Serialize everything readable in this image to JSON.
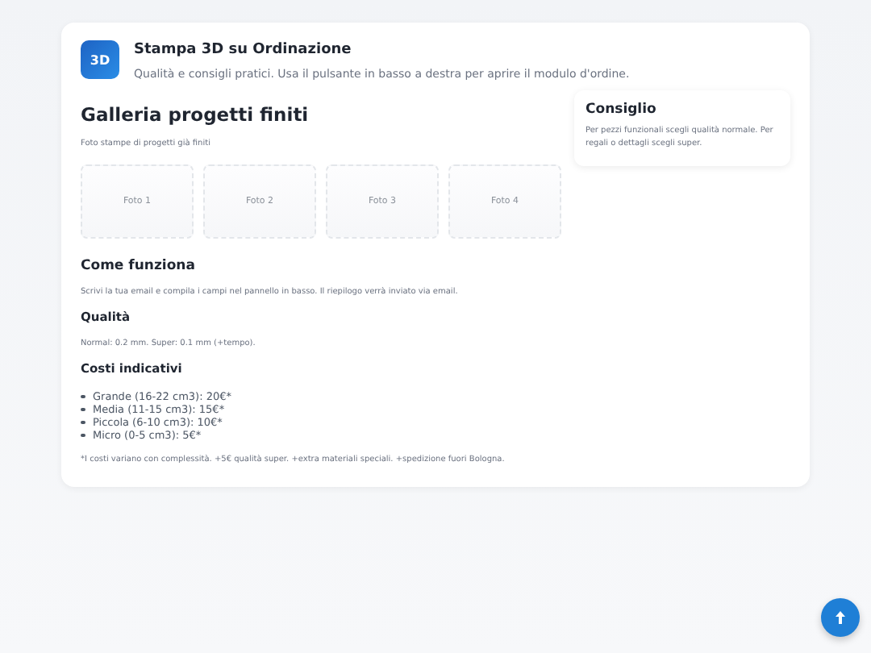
{
  "header": {
    "logo": "3D",
    "title": "Stampa 3D su Ordinazione",
    "subtitle": "Qualità e consigli pratici. Usa il pulsante in basso a destra per aprire il modulo d'ordine."
  },
  "gallery": {
    "title": "Galleria progetti finiti",
    "caption": "Foto stampe di progetti già finiti",
    "photos": [
      "Foto 1",
      "Foto 2",
      "Foto 3",
      "Foto 4"
    ]
  },
  "how": {
    "title": "Come funziona",
    "text": "Scrivi la tua email e compila i campi nel pannello in basso. Il riepilogo verrà inviato via email."
  },
  "quality": {
    "title": "Qualità",
    "text": "Normal: 0.2 mm. Super: 0.1 mm (+tempo)."
  },
  "costs": {
    "title": "Costi indicativi",
    "items": [
      "Grande (16-22 cm3): 20€*",
      "Media (11-15 cm3): 15€*",
      "Piccola (6-10 cm3): 10€*",
      "Micro (0-5 cm3): 5€*"
    ],
    "note": "*I costi variano con complessità. +5€ qualità super. +extra materiali speciali. +spedizione fuori Bologna."
  },
  "tip": {
    "title": "Consiglio",
    "text": "Per pezzi funzionali scegli qualità normale. Per regali o dettagli scegli super."
  }
}
